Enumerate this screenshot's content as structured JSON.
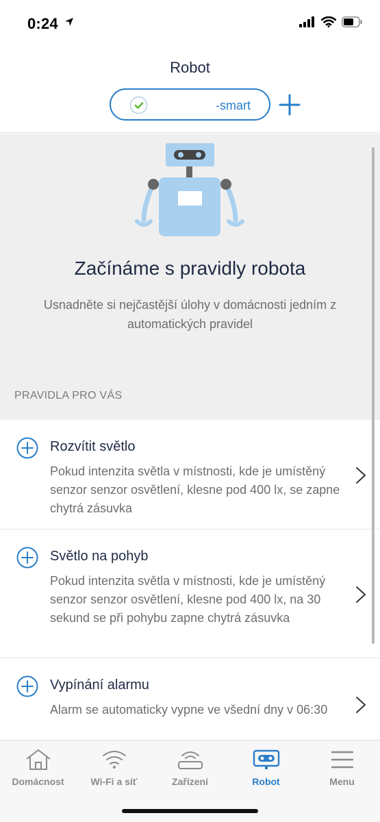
{
  "status_bar": {
    "time": "0:24"
  },
  "header": {
    "title": "Robot",
    "device_name": "-smart"
  },
  "hero": {
    "title": "Začínáme s pravidly robota",
    "subtitle": "Usnadněte si nejčastější úlohy v domácnosti jedním z automatických pravidel"
  },
  "section_label": "PRAVIDLA PRO VÁS",
  "rules": [
    {
      "title": "Rozvítit světlo",
      "description": "Pokud intenzita světla v místnosti, kde je umístěný senzor senzor osvětlení, klesne pod 400 lx, se zapne chytrá zásuvka"
    },
    {
      "title": "Světlo na pohyb",
      "description": "Pokud intenzita světla v místnosti, kde je umístěný senzor senzor osvětlení, klesne pod 400 lx, na 30 sekund se při pohybu zapne chytrá zásuvka"
    },
    {
      "title": "Vypínání alarmu",
      "description": "Alarm se automaticky vypne ve všední dny v 06:30"
    }
  ],
  "tabs": [
    {
      "label": "Domácnost",
      "icon": "home-icon"
    },
    {
      "label": "Wi-Fi a síť",
      "icon": "wifi-icon"
    },
    {
      "label": "Zařízení",
      "icon": "router-icon"
    },
    {
      "label": "Robot",
      "icon": "robot-icon"
    },
    {
      "label": "Menu",
      "icon": "menu-icon"
    }
  ],
  "colors": {
    "accent": "#2a7fc9",
    "check": "#5fb832",
    "robot": "#a9d0ef"
  }
}
